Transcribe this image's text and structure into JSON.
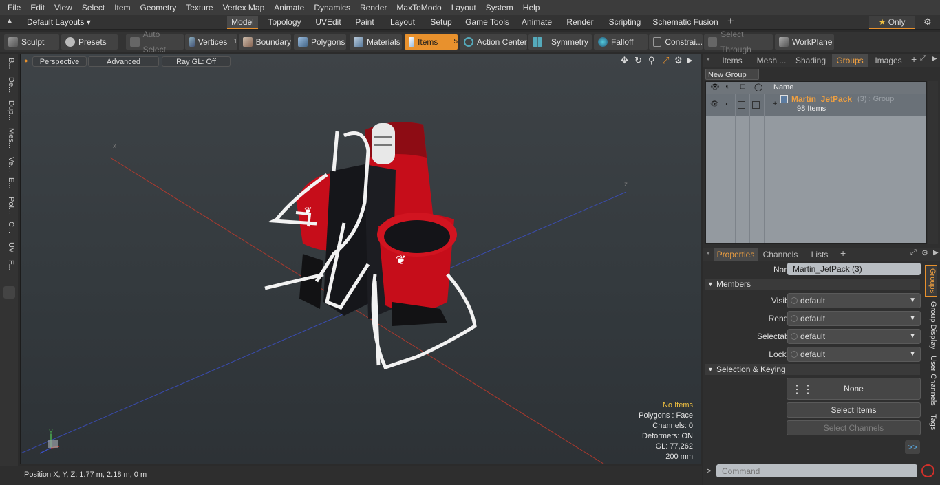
{
  "menu": [
    "File",
    "Edit",
    "View",
    "Select",
    "Item",
    "Geometry",
    "Texture",
    "Vertex Map",
    "Animate",
    "Dynamics",
    "Render",
    "MaxToModo",
    "Layout",
    "System",
    "Help"
  ],
  "layout": {
    "selector": "Default Layouts",
    "tabs": [
      "Model",
      "Topology",
      "UVEdit",
      "Paint",
      "Layout",
      "Setup",
      "Game Tools",
      "Animate",
      "Render",
      "Scripting",
      "Schematic Fusion"
    ],
    "only_label": "Only"
  },
  "toolbar": {
    "sculpt": "Sculpt",
    "presets": "Presets",
    "auto_select": "Auto Select",
    "vertices": "Vertices",
    "vertices_count": "1",
    "boundary": "Boundary",
    "polygons": "Polygons",
    "materials": "Materials",
    "items": "Items",
    "items_count": "5",
    "action_center": "Action Center",
    "symmetry": "Symmetry",
    "falloff": "Falloff",
    "constraints": "Constrai...",
    "select_through": "Select Through",
    "workplane": "WorkPlane"
  },
  "leftstrip": [
    "B...",
    "De...",
    "Dup...",
    "Mes...",
    "Ve...",
    "E...",
    "Pol...",
    "C...",
    "UV",
    "F..."
  ],
  "viewport": {
    "perspective": "Perspective",
    "advanced": "Advanced",
    "raygl": "Ray GL: Off",
    "info": {
      "no_items": "No Items",
      "polygons": "Polygons : Face",
      "channels": "Channels: 0",
      "deformers": "Deformers: ON",
      "gl": "GL: 77,262",
      "scale": "200 mm"
    }
  },
  "statusbar": {
    "position": "Position X, Y, Z:   1.77 m, 2.18 m, 0 m"
  },
  "right_top": {
    "tabs": [
      "Items",
      "Mesh ...",
      "Shading",
      "Groups",
      "Images"
    ],
    "new_group": "New Group",
    "name_header": "Name",
    "group_name": "Martin_JetPack",
    "group_suffix": "(3) : Group",
    "group_items": "98 Items"
  },
  "properties": {
    "tabs": [
      "Properties",
      "Channels",
      "Lists"
    ],
    "name_label": "Name",
    "name_value": "Martin_JetPack (3)",
    "members": "Members",
    "visible_label": "Visible",
    "render_label": "Render",
    "selectable_label": "Selectable",
    "locked_label": "Locked",
    "default": "default",
    "selection_keying": "Selection & Keying",
    "none": "None",
    "select_items": "Select Items",
    "select_channels": "Select Channels",
    "side_tabs": [
      "Groups",
      "Group Display",
      "User Channels",
      "Tags"
    ],
    "more": ">>"
  },
  "command": {
    "placeholder": "Command"
  },
  "colors": {
    "accent": "#e8912d",
    "jetpack_red": "#d0101c"
  }
}
